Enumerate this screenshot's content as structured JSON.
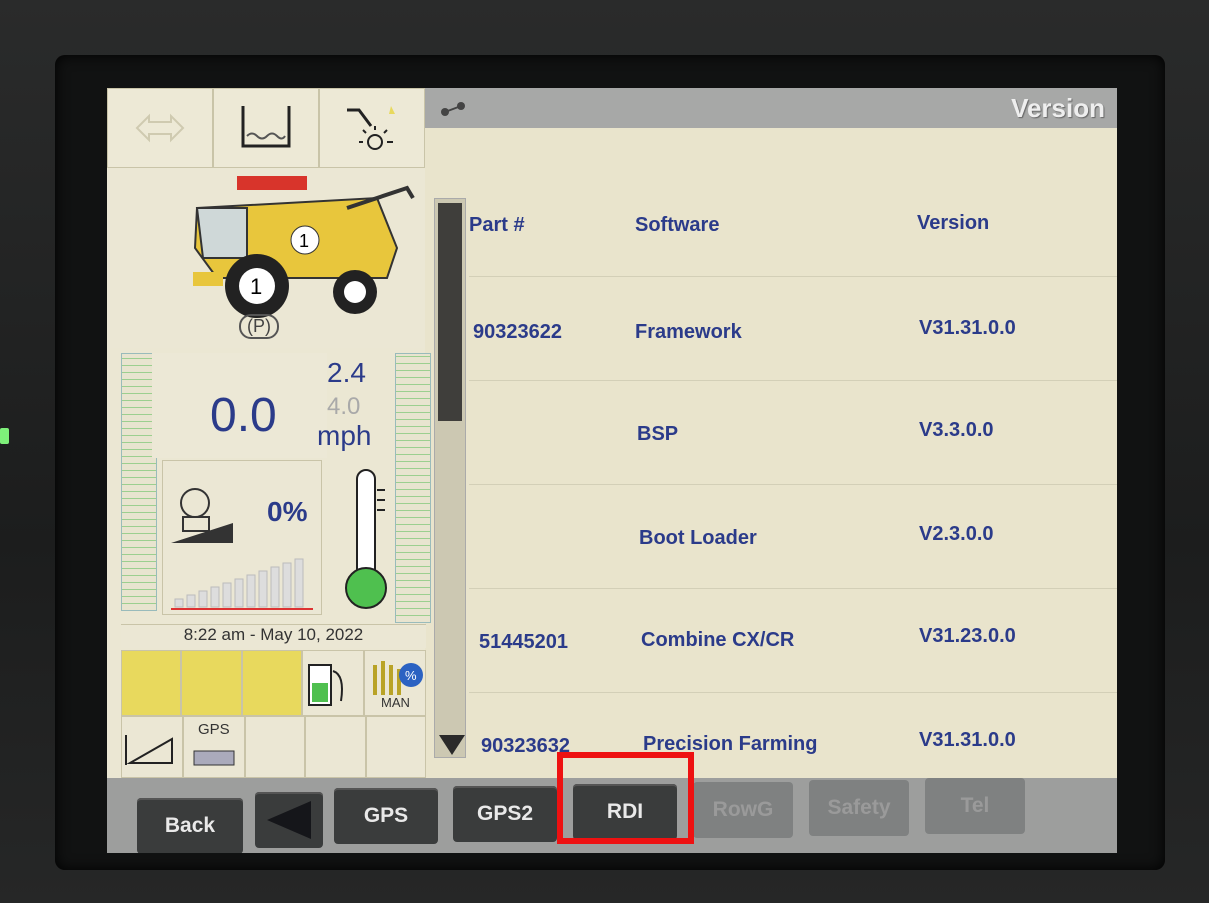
{
  "screen": {
    "header_title": "Version",
    "header_icon": "combine-link-icon"
  },
  "left_panel": {
    "park_indicator": "(P)",
    "speed_value": "0.0",
    "speed_setpoint_1": "2.4",
    "speed_setpoint_2": "4.0",
    "speed_unit": "mph",
    "engine_load": "0%",
    "datetime": "8:22 am - May 10, 2022",
    "gps_label": "GPS",
    "man_label": "MAN",
    "icons": [
      "transport-icon",
      "hopper-icon",
      "header-light-icon",
      "combine-icon",
      "engine-icon",
      "thermometer-icon",
      "fuel-icon",
      "crop-moisture-icon",
      "header-height-icon",
      "gps-receiver-icon"
    ]
  },
  "table": {
    "headers": {
      "part": "Part #",
      "software": "Software",
      "version": "Version"
    },
    "rows": [
      {
        "part": "90323622",
        "software": "Framework",
        "version": "V31.31.0.0"
      },
      {
        "part": "",
        "software": "BSP",
        "version": "V3.3.0.0"
      },
      {
        "part": "",
        "software": "Boot Loader",
        "version": "V2.3.0.0"
      },
      {
        "part": "51445201",
        "software": "Combine CX/CR",
        "version": "V31.23.0.0"
      },
      {
        "part": "90323632",
        "software": "Precision Farming",
        "version": "V31.31.0.0"
      }
    ]
  },
  "buttons": [
    {
      "label": "Back",
      "enabled": true
    },
    {
      "label": "",
      "enabled": true,
      "icon": "left-arrow-icon"
    },
    {
      "label": "GPS",
      "enabled": true
    },
    {
      "label": "GPS2",
      "enabled": true
    },
    {
      "label": "RDI",
      "enabled": true,
      "highlighted": true
    },
    {
      "label": "RowG",
      "enabled": false
    },
    {
      "label": "Safety",
      "enabled": false
    },
    {
      "label": "Tel",
      "enabled": false
    }
  ],
  "colors": {
    "highlight": "#ee1111",
    "text_blue": "#2b3b8a"
  }
}
